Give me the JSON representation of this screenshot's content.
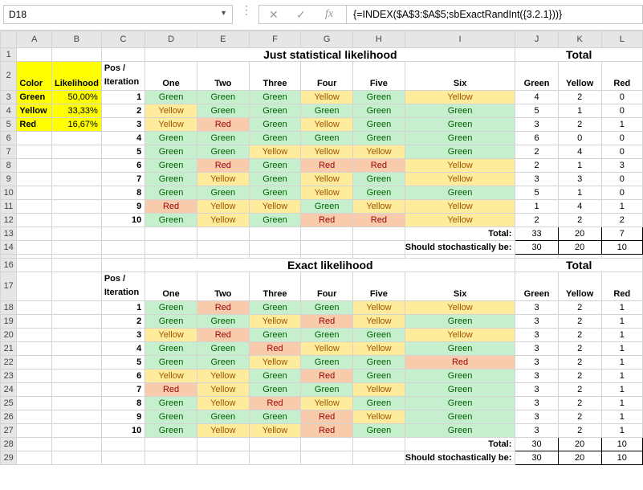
{
  "formula_bar": {
    "name_box": "D18",
    "cancel_icon": "✕",
    "enter_icon": "✓",
    "fx_label": "fx",
    "formula": "{=INDEX($A$3:$A$5;sbExactRandInt({3.2.1}))}"
  },
  "columns": [
    "A",
    "B",
    "C",
    "D",
    "E",
    "F",
    "G",
    "H",
    "I",
    "J",
    "K",
    "L"
  ],
  "legend": {
    "header_color": "Color",
    "header_likelihood": "Likelihood",
    "rows": [
      {
        "color": "Green",
        "likelihood": "50,00%"
      },
      {
        "color": "Yellow",
        "likelihood": "33,33%"
      },
      {
        "color": "Red",
        "likelihood": "16,67%"
      }
    ]
  },
  "section1": {
    "title": "Just statistical likelihood",
    "total_title": "Total",
    "pos_label_1": "Pos /",
    "pos_label_2": "Iteration",
    "headers": [
      "One",
      "Two",
      "Three",
      "Four",
      "Five",
      "Six"
    ],
    "total_headers": [
      "Green",
      "Yellow",
      "Red"
    ],
    "rows": [
      {
        "n": "1",
        "cells": [
          "Green",
          "Green",
          "Green",
          "Yellow",
          "Green",
          "Yellow"
        ],
        "totals": [
          "4",
          "2",
          "0"
        ]
      },
      {
        "n": "2",
        "cells": [
          "Yellow",
          "Green",
          "Green",
          "Green",
          "Green",
          "Green"
        ],
        "totals": [
          "5",
          "1",
          "0"
        ]
      },
      {
        "n": "3",
        "cells": [
          "Yellow",
          "Red",
          "Green",
          "Yellow",
          "Green",
          "Green"
        ],
        "totals": [
          "3",
          "2",
          "1"
        ]
      },
      {
        "n": "4",
        "cells": [
          "Green",
          "Green",
          "Green",
          "Green",
          "Green",
          "Green"
        ],
        "totals": [
          "6",
          "0",
          "0"
        ]
      },
      {
        "n": "5",
        "cells": [
          "Green",
          "Green",
          "Yellow",
          "Yellow",
          "Yellow",
          "Green"
        ],
        "totals": [
          "2",
          "4",
          "0"
        ]
      },
      {
        "n": "6",
        "cells": [
          "Green",
          "Red",
          "Green",
          "Red",
          "Red",
          "Yellow"
        ],
        "totals": [
          "2",
          "1",
          "3"
        ]
      },
      {
        "n": "7",
        "cells": [
          "Green",
          "Yellow",
          "Green",
          "Yellow",
          "Green",
          "Yellow"
        ],
        "totals": [
          "3",
          "3",
          "0"
        ]
      },
      {
        "n": "8",
        "cells": [
          "Green",
          "Green",
          "Green",
          "Yellow",
          "Green",
          "Green"
        ],
        "totals": [
          "5",
          "1",
          "0"
        ]
      },
      {
        "n": "9",
        "cells": [
          "Red",
          "Yellow",
          "Yellow",
          "Green",
          "Yellow",
          "Yellow"
        ],
        "totals": [
          "1",
          "4",
          "1"
        ]
      },
      {
        "n": "10",
        "cells": [
          "Green",
          "Yellow",
          "Green",
          "Red",
          "Red",
          "Yellow"
        ],
        "totals": [
          "2",
          "2",
          "2"
        ]
      }
    ],
    "total_label": "Total:",
    "total_values": [
      "33",
      "20",
      "7"
    ],
    "should_label": "Should stochastically be:",
    "should_values": [
      "30",
      "20",
      "10"
    ]
  },
  "section2": {
    "title": "Exact likelihood",
    "total_title": "Total",
    "pos_label_1": "Pos /",
    "pos_label_2": "Iteration",
    "headers": [
      "One",
      "Two",
      "Three",
      "Four",
      "Five",
      "Six"
    ],
    "total_headers": [
      "Green",
      "Yellow",
      "Red"
    ],
    "rows": [
      {
        "n": "1",
        "cells": [
          "Green",
          "Red",
          "Green",
          "Green",
          "Yellow",
          "Yellow"
        ],
        "totals": [
          "3",
          "2",
          "1"
        ]
      },
      {
        "n": "2",
        "cells": [
          "Green",
          "Green",
          "Yellow",
          "Red",
          "Yellow",
          "Green"
        ],
        "totals": [
          "3",
          "2",
          "1"
        ]
      },
      {
        "n": "3",
        "cells": [
          "Yellow",
          "Red",
          "Green",
          "Green",
          "Green",
          "Yellow"
        ],
        "totals": [
          "3",
          "2",
          "1"
        ]
      },
      {
        "n": "4",
        "cells": [
          "Green",
          "Green",
          "Red",
          "Yellow",
          "Yellow",
          "Green"
        ],
        "totals": [
          "3",
          "2",
          "1"
        ]
      },
      {
        "n": "5",
        "cells": [
          "Green",
          "Green",
          "Yellow",
          "Green",
          "Green",
          "Red"
        ],
        "totals": [
          "3",
          "2",
          "1"
        ]
      },
      {
        "n": "6",
        "cells": [
          "Yellow",
          "Yellow",
          "Green",
          "Red",
          "Green",
          "Green"
        ],
        "totals": [
          "3",
          "2",
          "1"
        ]
      },
      {
        "n": "7",
        "cells": [
          "Red",
          "Yellow",
          "Green",
          "Green",
          "Yellow",
          "Green"
        ],
        "totals": [
          "3",
          "2",
          "1"
        ]
      },
      {
        "n": "8",
        "cells": [
          "Green",
          "Yellow",
          "Red",
          "Yellow",
          "Green",
          "Green"
        ],
        "totals": [
          "3",
          "2",
          "1"
        ]
      },
      {
        "n": "9",
        "cells": [
          "Green",
          "Green",
          "Green",
          "Red",
          "Yellow",
          "Green"
        ],
        "totals": [
          "3",
          "2",
          "1"
        ]
      },
      {
        "n": "10",
        "cells": [
          "Green",
          "Yellow",
          "Yellow",
          "Red",
          "Green",
          "Green"
        ],
        "totals": [
          "3",
          "2",
          "1"
        ]
      }
    ],
    "total_label": "Total:",
    "total_values": [
      "30",
      "20",
      "10"
    ],
    "should_label": "Should stochastically be:",
    "should_values": [
      "30",
      "20",
      "10"
    ]
  },
  "row_numbers": {
    "r1": "1",
    "r2": "2",
    "r13": "13",
    "r14": "14",
    "r15": "15",
    "r16": "16",
    "r17": "17",
    "r28": "28",
    "r29": "29"
  },
  "colors": {
    "green_fill": "#c6efce",
    "green_text": "#006100",
    "yellow_fill": "#ffeb9c",
    "yellow_text": "#9c5700",
    "red_fill": "#f8cbad",
    "red_text": "#9c0006",
    "highlight": "#ffff00"
  }
}
